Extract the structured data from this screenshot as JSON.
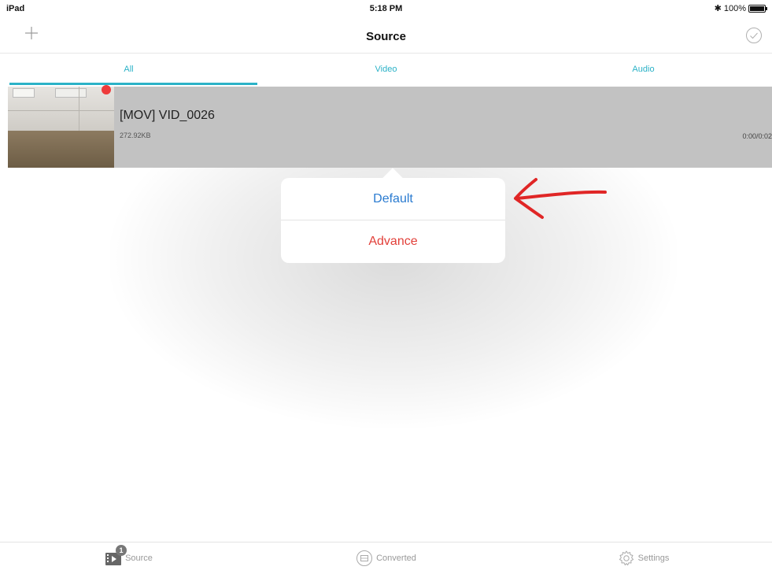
{
  "status_bar": {
    "device": "iPad",
    "time": "5:18 PM",
    "battery": "100%"
  },
  "nav": {
    "title": "Source",
    "add_icon": "plus-icon",
    "select_icon": "check-circle-icon"
  },
  "tabs": [
    {
      "label": "All",
      "active": true
    },
    {
      "label": "Video",
      "active": false
    },
    {
      "label": "Audio",
      "active": false
    }
  ],
  "files": [
    {
      "name": "[MOV] VID_0026",
      "size": "272.92KB",
      "duration": "0:00/0:02"
    }
  ],
  "popover": {
    "items": [
      "Default",
      "Advance"
    ]
  },
  "tab_bar": {
    "items": [
      {
        "label": "Source",
        "badge": "1",
        "icon": "source-film-icon"
      },
      {
        "label": "Converted",
        "icon": "converted-icon"
      },
      {
        "label": "Settings",
        "icon": "gear-icon"
      }
    ]
  },
  "colors": {
    "accent": "#2bb2c7",
    "link_blue": "#2a7bd0",
    "destructive_red": "#e2403a",
    "annotation_red": "#e02626"
  }
}
